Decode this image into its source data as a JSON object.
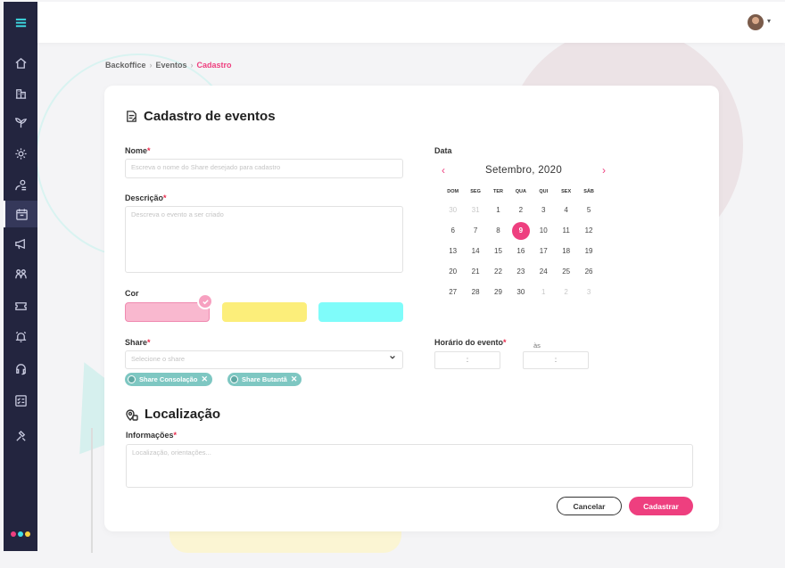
{
  "topbar": {
    "avatar_caret": "▾"
  },
  "sidebar": {
    "items": [
      {
        "name": "home"
      },
      {
        "name": "buildings"
      },
      {
        "name": "plant"
      },
      {
        "name": "gear"
      },
      {
        "name": "settings-people"
      },
      {
        "name": "calendar",
        "active": true
      },
      {
        "name": "megaphone"
      },
      {
        "name": "group"
      },
      {
        "name": "ticket"
      },
      {
        "name": "alarm"
      },
      {
        "name": "support"
      },
      {
        "name": "checklist"
      },
      {
        "name": "tools"
      }
    ]
  },
  "breadcrumb": {
    "items": [
      "Backoffice",
      "Eventos"
    ],
    "current": "Cadastro",
    "separator": "›"
  },
  "form": {
    "title": "Cadastro de eventos",
    "name_label": "Nome",
    "name_placeholder": "Escreva o nome do Share desejado para cadastro",
    "desc_label": "Descrição",
    "desc_placeholder": "Descreva o evento a ser criado",
    "color_label": "Cor",
    "colors": [
      "#f9b8cf",
      "#fcee7a",
      "#7ffcfa"
    ],
    "selected_color_index": 0,
    "share_label": "Share",
    "share_placeholder": "Selecione o share",
    "share_chips": [
      "Share Consolação",
      "Share Butantã"
    ],
    "required_mark": "*"
  },
  "calendar": {
    "label": "Data",
    "month": "Setembro, 2020",
    "prev": "‹",
    "next": "›",
    "weekdays": [
      "DOM",
      "SEG",
      "TER",
      "QUA",
      "QUI",
      "SEX",
      "SÁB"
    ],
    "days": [
      {
        "d": "30",
        "muted": true
      },
      {
        "d": "31",
        "muted": true
      },
      {
        "d": "1"
      },
      {
        "d": "2"
      },
      {
        "d": "3"
      },
      {
        "d": "4"
      },
      {
        "d": "5"
      },
      {
        "d": "6"
      },
      {
        "d": "7"
      },
      {
        "d": "8"
      },
      {
        "d": "9",
        "selected": true
      },
      {
        "d": "10"
      },
      {
        "d": "11"
      },
      {
        "d": "12"
      },
      {
        "d": "13"
      },
      {
        "d": "14"
      },
      {
        "d": "15"
      },
      {
        "d": "16"
      },
      {
        "d": "17"
      },
      {
        "d": "18"
      },
      {
        "d": "19"
      },
      {
        "d": "20"
      },
      {
        "d": "21"
      },
      {
        "d": "22"
      },
      {
        "d": "23"
      },
      {
        "d": "24"
      },
      {
        "d": "25"
      },
      {
        "d": "26"
      },
      {
        "d": "27"
      },
      {
        "d": "28"
      },
      {
        "d": "29"
      },
      {
        "d": "30"
      },
      {
        "d": "1",
        "muted": true
      },
      {
        "d": "2",
        "muted": true
      },
      {
        "d": "3",
        "muted": true
      }
    ]
  },
  "time": {
    "label": "Horário do evento",
    "start": ":",
    "end": ":",
    "separator": "às"
  },
  "location": {
    "title": "Localização",
    "info_label": "Informações",
    "info_placeholder": "Localização, orientações..."
  },
  "actions": {
    "cancel": "Cancelar",
    "submit": "Cadastrar"
  },
  "colors": {
    "accent": "#ee3f7f",
    "sidebar": "#23253f",
    "chip": "#7ec7c2",
    "logo": [
      "#ee3f7f",
      "#3ee0e8",
      "#f7d23e"
    ]
  }
}
